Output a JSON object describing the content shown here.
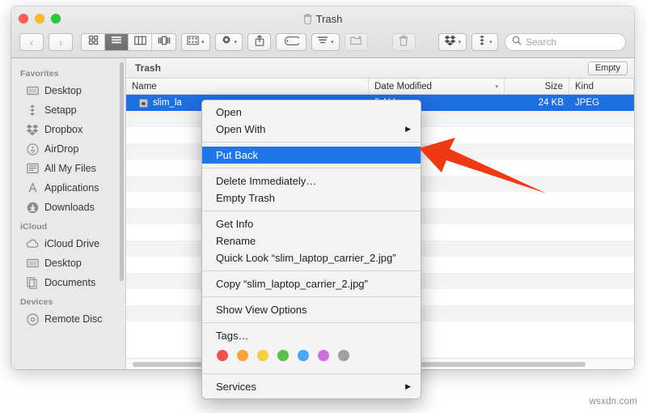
{
  "window": {
    "title": "Trash",
    "title_icon": "trash-icon",
    "traffic_lights": [
      {
        "name": "close",
        "color": "#ff5f57"
      },
      {
        "name": "minimize",
        "color": "#febc2e"
      },
      {
        "name": "zoom",
        "color": "#28c840"
      }
    ]
  },
  "toolbar": {
    "back_label": "‹",
    "forward_label": "›",
    "view_modes": [
      {
        "name": "icon-view",
        "selected": false
      },
      {
        "name": "list-view",
        "selected": true
      },
      {
        "name": "column-view",
        "selected": false
      },
      {
        "name": "coverflow-view",
        "selected": false
      }
    ],
    "arrange_icon": "arrange-grid-icon",
    "action_icon": "gear-icon",
    "share_icon": "share-icon",
    "tag_icon": "tag-icon",
    "sort_icon": "sort-lines-icon",
    "newfolder_icon": "new-folder-icon",
    "delete_icon": "trash-icon",
    "dropbox_icon": "dropbox-icon",
    "setapp_icon": "setapp-icon",
    "caret": "▾"
  },
  "search": {
    "icon": "search-icon",
    "placeholder": "Search",
    "value": ""
  },
  "sidebar": {
    "sections": [
      {
        "header": "Favorites",
        "items": [
          {
            "label": "Desktop",
            "icon": "desktop-icon"
          },
          {
            "label": "Setapp",
            "icon": "setapp-icon"
          },
          {
            "label": "Dropbox",
            "icon": "dropbox-icon"
          },
          {
            "label": "AirDrop",
            "icon": "airdrop-icon"
          },
          {
            "label": "All My Files",
            "icon": "all-my-files-icon"
          },
          {
            "label": "Applications",
            "icon": "applications-icon"
          },
          {
            "label": "Downloads",
            "icon": "downloads-icon"
          }
        ]
      },
      {
        "header": "iCloud",
        "items": [
          {
            "label": "iCloud Drive",
            "icon": "cloud-icon"
          },
          {
            "label": "Desktop",
            "icon": "desktop-icon"
          },
          {
            "label": "Documents",
            "icon": "documents-icon"
          }
        ]
      },
      {
        "header": "Devices",
        "items": [
          {
            "label": "Remote Disc",
            "icon": "disc-icon"
          }
        ]
      }
    ]
  },
  "path_bar": {
    "label": "Trash",
    "empty_button": "Empty"
  },
  "file_list": {
    "columns": [
      {
        "key": "name",
        "label": "Name"
      },
      {
        "key": "date",
        "label": "Date Modified",
        "sort_caret": "⌄"
      },
      {
        "key": "size",
        "label": "Size"
      },
      {
        "key": "kind",
        "label": "Kind"
      }
    ],
    "rows": [
      {
        "name": "slim_la",
        "date": "5 AM",
        "size": "24 KB",
        "kind": "JPEG",
        "icon": "jpeg-file-icon",
        "selected": true
      }
    ],
    "empty_row_count": 14
  },
  "context_menu": {
    "groups": [
      {
        "items": [
          {
            "label": "Open",
            "submenu": false,
            "highlighted": false
          },
          {
            "label": "Open With",
            "submenu": true,
            "highlighted": false,
            "arrow": "▶"
          }
        ]
      },
      {
        "items": [
          {
            "label": "Put Back",
            "submenu": false,
            "highlighted": true
          }
        ]
      },
      {
        "items": [
          {
            "label": "Delete Immediately…",
            "submenu": false,
            "highlighted": false
          },
          {
            "label": "Empty Trash",
            "submenu": false,
            "highlighted": false
          }
        ]
      },
      {
        "items": [
          {
            "label": "Get Info",
            "submenu": false,
            "highlighted": false
          },
          {
            "label": "Rename",
            "submenu": false,
            "highlighted": false
          },
          {
            "label": "Quick Look “slim_laptop_carrier_2.jpg”",
            "submenu": false,
            "highlighted": false
          }
        ]
      },
      {
        "items": [
          {
            "label": "Copy “slim_laptop_carrier_2.jpg”",
            "submenu": false,
            "highlighted": false
          }
        ]
      },
      {
        "items": [
          {
            "label": "Show View Options",
            "submenu": false,
            "highlighted": false
          }
        ]
      },
      {
        "items": [
          {
            "label": "Tags…",
            "submenu": false,
            "highlighted": false
          }
        ],
        "tags": [
          {
            "name": "red",
            "color": "#ef5350"
          },
          {
            "name": "orange",
            "color": "#f5a33c"
          },
          {
            "name": "yellow",
            "color": "#f2cf3e"
          },
          {
            "name": "green",
            "color": "#5ec14e"
          },
          {
            "name": "blue",
            "color": "#4fa8ef"
          },
          {
            "name": "purple",
            "color": "#cf6fdc"
          },
          {
            "name": "gray",
            "color": "#a0a0a0"
          }
        ]
      },
      {
        "items": [
          {
            "label": "Services",
            "submenu": true,
            "highlighted": false,
            "arrow": "▶"
          }
        ]
      }
    ]
  },
  "annotation": {
    "arrow_color": "#ee3a14",
    "arrow_target": "Put Back"
  },
  "watermark": {
    "text": "wsxdn.com"
  }
}
